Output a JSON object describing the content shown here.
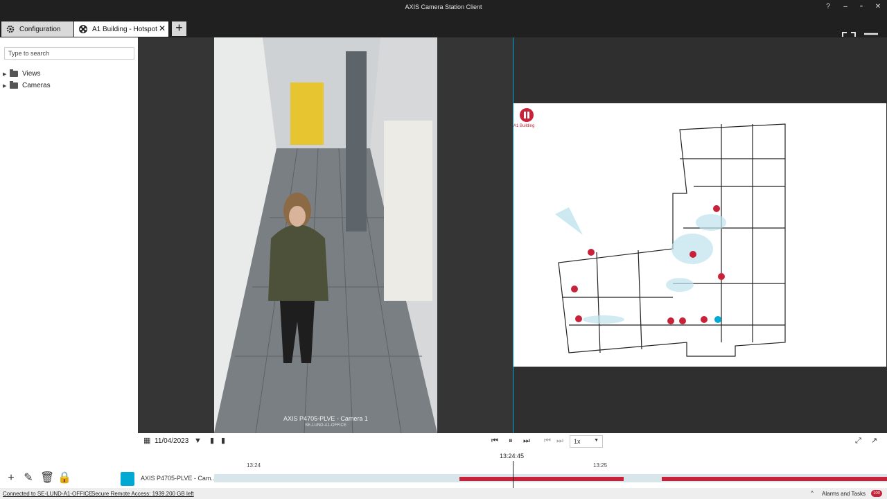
{
  "window": {
    "title": "AXIS Camera Station Client",
    "help": "?",
    "minimize": "–",
    "restore": "▫",
    "close": "✕"
  },
  "tabs": [
    {
      "label": "Configuration"
    },
    {
      "label": "A1 Building - Hotspot",
      "close": "✕"
    }
  ],
  "add_tab": "+",
  "sidebar": {
    "search_placeholder": "Type to search",
    "items": [
      {
        "label": "Views"
      },
      {
        "label": "Cameras"
      }
    ]
  },
  "camera_view": {
    "label": "AXIS P4705-PLVE - Camera 1",
    "sublabel": "SE-LUND-A1-OFFICE"
  },
  "map": {
    "title_text": "A1 Building"
  },
  "controls": {
    "date": "11/04/2023",
    "speed": "1x"
  },
  "timeline": {
    "current_time": "13:24:45",
    "ticks": [
      "13:24",
      "13:25"
    ],
    "camera_label": "AXIS P4705-PLVE - Cam...",
    "recordings": [
      {
        "start_frac": 0.365,
        "end_frac": 0.609
      },
      {
        "start_frac": 0.665,
        "end_frac": 1.0
      }
    ]
  },
  "status": {
    "connection": "Connected to SE-LUND-A1-OFFICE",
    "remote": "Secure Remote Access: 1939.200 GB left",
    "alarms": "Alarms and Tasks",
    "alarm_count": "100"
  },
  "colors": {
    "accent": "#00a9d4",
    "recording": "#c8213a",
    "titlebar": "#202020"
  }
}
